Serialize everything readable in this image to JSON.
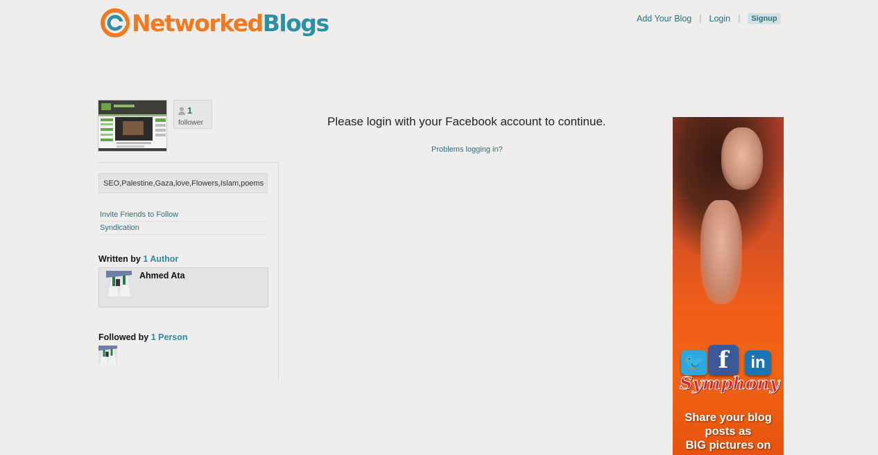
{
  "header": {
    "logo_part1": "Networked",
    "logo_part2": "Blogs",
    "nav": {
      "add_blog": "Add Your Blog",
      "separator": "|",
      "login": "Login",
      "signup": "Signup"
    }
  },
  "blog": {
    "followers": {
      "count": "1",
      "label": "follower"
    },
    "tags": "SEO,Palestine,Gaza,love,Flowers,Islam,poems",
    "links": [
      {
        "label": "Invite Friends to Follow"
      },
      {
        "label": "Syndication"
      }
    ],
    "written_by": {
      "prefix": "Written by",
      "count_label": "1 Author",
      "author_name": "Ahmed Ata"
    },
    "followed_by": {
      "prefix": "Followed by",
      "count_label": "1 Person"
    }
  },
  "main": {
    "message": "Please login with your Facebook account to continue.",
    "problems_link": "Problems logging in?"
  },
  "ad": {
    "brand": "Symphony",
    "icons": [
      "twitter-icon",
      "facebook-icon",
      "linkedin-icon"
    ],
    "tagline": [
      "Share your blog",
      "posts as",
      "BIG pictures on"
    ]
  },
  "colors": {
    "link": "#2a6f80",
    "logo_orange": "#f07a21",
    "logo_teal": "#2c8fa5",
    "background": "#efeeec"
  }
}
